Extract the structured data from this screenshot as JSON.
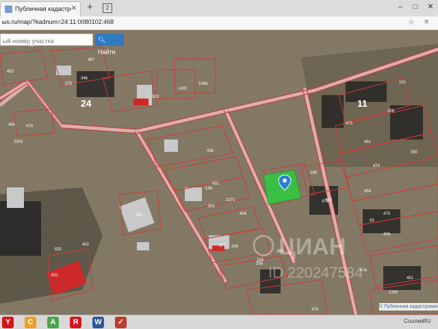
{
  "browser": {
    "tab_title": "Публичная кадастровая кар",
    "new_tab": "+",
    "tab_count": "2",
    "url": "ыs.ru/map/?kadnum=24:11:0080102:468"
  },
  "search": {
    "placeholder": "ый номер участка",
    "button_label": "Найти"
  },
  "map": {
    "labels": [
      {
        "t": "24",
        "big": true
      },
      {
        "t": "11",
        "big": true
      },
      {
        "t": "467"
      },
      {
        "t": "346"
      },
      {
        "t": "469"
      },
      {
        "t": "1403"
      },
      {
        "t": "1066"
      },
      {
        "t": "503"
      },
      {
        "t": "473"
      },
      {
        "t": "452"
      },
      {
        "t": "436"
      },
      {
        "t": "136"
      },
      {
        "t": "1071"
      },
      {
        "t": "473"
      },
      {
        "t": "101"
      },
      {
        "t": "208"
      },
      {
        "t": "451"
      },
      {
        "t": "350"
      },
      {
        "t": "188"
      },
      {
        "t": "474"
      },
      {
        "t": "454"
      },
      {
        "t": "404"
      },
      {
        "t": "431"
      },
      {
        "t": "93"
      },
      {
        "t": "475"
      },
      {
        "t": "476"
      },
      {
        "t": "377"
      },
      {
        "t": "336"
      },
      {
        "t": "402"
      },
      {
        "t": "384"
      },
      {
        "t": "301"
      },
      {
        "t": "206"
      },
      {
        "t": "289"
      },
      {
        "t": "249"
      },
      {
        "t": "474"
      },
      {
        "t": "474"
      },
      {
        "t": "2003"
      },
      {
        "t": "451"
      },
      {
        "t": "1200"
      },
      {
        "t": "832"
      },
      {
        "t": "831"
      },
      {
        "t": "406"
      },
      {
        "t": "370"
      },
      {
        "t": "450"
      },
      {
        "t": "453"
      },
      {
        "t": "48"
      },
      {
        "t": "470"
      }
    ],
    "watermark": "ЦИАН",
    "watermark_id": "ID 220247584",
    "attribution": "© Публичная кадастровая карта"
  },
  "taskbar": {
    "apps": [
      {
        "glyph": "Y",
        "color": "#d5141b"
      },
      {
        "glyph": "C",
        "color": "#f0a020"
      },
      {
        "glyph": "A",
        "color": "#4aa64a"
      },
      {
        "glyph": "Я",
        "color": "#d5141b"
      },
      {
        "glyph": "W",
        "color": "#2b579a"
      },
      {
        "glyph": "✓",
        "color": "#c0392b"
      }
    ],
    "links_label": "Ссылки",
    "lang": "RU"
  },
  "colors": {
    "selected_parcel": "#2ecc40",
    "parcel_border": "#d13a3a",
    "accent": "#2f7ac1"
  }
}
